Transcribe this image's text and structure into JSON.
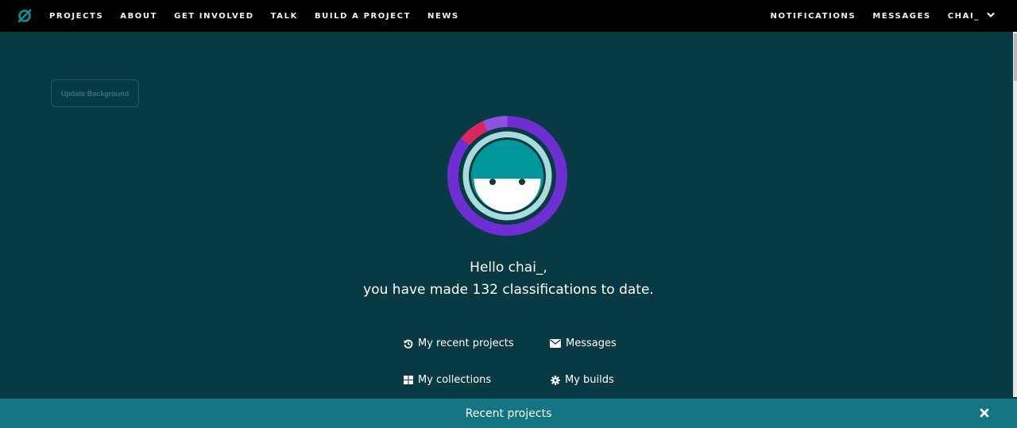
{
  "nav": {
    "left": [
      "PROJECTS",
      "ABOUT",
      "GET INVOLVED",
      "TALK",
      "BUILD A PROJECT",
      "NEWS"
    ],
    "notifications": "NOTIFICATIONS",
    "messages": "MESSAGES",
    "user": "CHAI_"
  },
  "profile": {
    "update_background": "Update Background",
    "greeting_line1": "Hello chai_,",
    "greeting_line2": "you have made 132 classifications to date."
  },
  "links": {
    "recent_projects": "My recent projects",
    "messages": "Messages",
    "collections": "My collections",
    "builds": "My builds"
  },
  "recent_bar": {
    "title": "Recent projects"
  },
  "colors": {
    "background": "#083a43",
    "nav": "#000000",
    "accent_teal": "#00979d",
    "ring_purple": "#6d2fd2",
    "ring_red": "#d9265d",
    "recent_bar": "#137482"
  },
  "icons": {
    "logo": "zooniverse-logo-icon",
    "user_menu": "chevron-down-icon",
    "recent": "history-icon",
    "messages": "envelope-icon",
    "collections": "grid-icon",
    "builds": "cog-icon",
    "close": "close-icon"
  }
}
